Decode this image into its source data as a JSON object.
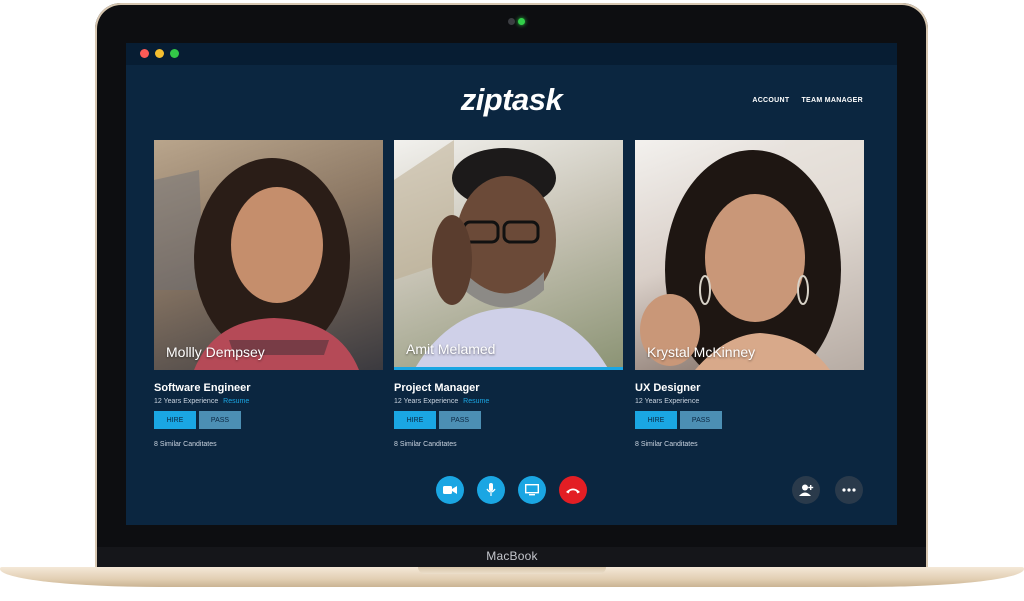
{
  "app": {
    "logo": "ziptask"
  },
  "nav": {
    "account": "ACCOUNT",
    "team_manager": "TEAM MANAGER"
  },
  "device": {
    "brand": "MacBook"
  },
  "candidates": [
    {
      "name": "Mollly Dempsey",
      "role": "Software Engineer",
      "experience": "12 Years Experience",
      "resume": "Resume",
      "hire": "HIRE",
      "pass": "PASS",
      "similar": "8 Similar Canditates"
    },
    {
      "name": "Amit Melamed",
      "role": "Project Manager",
      "experience": "12 Years Experience",
      "resume": "Resume",
      "hire": "HIRE",
      "pass": "PASS",
      "similar": "8 Similar Canditates"
    },
    {
      "name": "Krystal McKinney",
      "role": "UX Designer",
      "experience": "12 Years Experience",
      "hire": "HIRE",
      "pass": "PASS",
      "similar": "8 Similar Canditates"
    }
  ],
  "controls": [
    {
      "icon": "video-camera-icon",
      "color": "#1aa6e3"
    },
    {
      "icon": "microphone-icon",
      "color": "#1aa6e3"
    },
    {
      "icon": "screen-share-icon",
      "color": "#1aa6e3"
    },
    {
      "icon": "end-call-icon",
      "color": "#e31e24"
    },
    {
      "icon": "add-person-icon",
      "color": "#2a3a4b"
    },
    {
      "icon": "more-options-icon",
      "color": "#2a3a4b"
    }
  ],
  "colors": {
    "accent": "#1aa6e3",
    "background": "#0b2640",
    "danger": "#e31e24"
  }
}
